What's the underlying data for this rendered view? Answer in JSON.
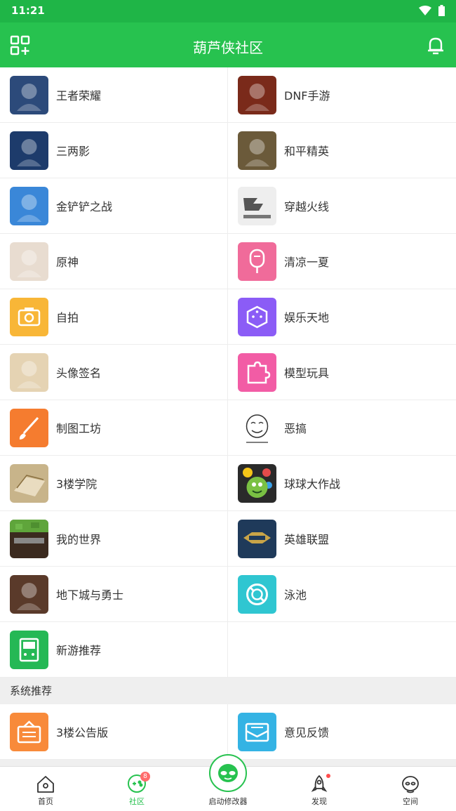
{
  "status": {
    "time": "11:21"
  },
  "header": {
    "title": "葫芦侠社区"
  },
  "icons": {
    "left": "qr-add-icon",
    "right": "bell-icon"
  },
  "colors": {
    "primary": "#27c24f",
    "status": "#1fb547"
  },
  "forums": [
    {
      "name": "王者荣耀",
      "icon": "honor-of-kings-icon",
      "color": "#2c4a7a"
    },
    {
      "name": "DNF手游",
      "icon": "dnf-icon",
      "color": "#7a2a1a"
    },
    {
      "name": "三两影",
      "icon": "sanliangying-icon",
      "color": "#1d3b6b"
    },
    {
      "name": "和平精英",
      "icon": "peace-elite-icon",
      "color": "#6b5a3a"
    },
    {
      "name": "金铲铲之战",
      "icon": "golden-spatula-icon",
      "color": "#3a87d8"
    },
    {
      "name": "穿越火线",
      "icon": "crossfire-icon",
      "color": "#bbbbbb"
    },
    {
      "name": "原神",
      "icon": "genshin-icon",
      "color": "#e8dcd0"
    },
    {
      "name": "清凉一夏",
      "icon": "ice-pop-icon",
      "color": "#f06b9a"
    },
    {
      "name": "自拍",
      "icon": "camera-icon",
      "color": "#f8b637"
    },
    {
      "name": "娱乐天地",
      "icon": "dice-icon",
      "color": "#8b5cf6"
    },
    {
      "name": "头像签名",
      "icon": "avatar-signature-icon",
      "color": "#e5d3b3"
    },
    {
      "name": "模型玩具",
      "icon": "puzzle-icon",
      "color": "#f25ca5"
    },
    {
      "name": "制图工坊",
      "icon": "brush-icon",
      "color": "#f57c2f"
    },
    {
      "name": "恶搞",
      "icon": "meme-face-icon",
      "color": "#ffffff"
    },
    {
      "name": "3楼学院",
      "icon": "books-icon",
      "color": "#c8b48a"
    },
    {
      "name": "球球大作战",
      "icon": "balls-icon",
      "color": "#7ac143"
    },
    {
      "name": "我的世界",
      "icon": "minecraft-icon",
      "color": "#3b2a1f"
    },
    {
      "name": "英雄联盟",
      "icon": "lol-icon",
      "color": "#1f3a5a"
    },
    {
      "name": "地下城与勇士",
      "icon": "dnf-pc-icon",
      "color": "#5a3a2a"
    },
    {
      "name": "泳池",
      "icon": "lifebuoy-icon",
      "color": "#2fc6d1"
    },
    {
      "name": "新游推荐",
      "icon": "new-game-icon",
      "color": "#25b855"
    }
  ],
  "system_section": {
    "title": "系统推荐",
    "items": [
      {
        "name": "3楼公告版",
        "icon": "notice-board-icon",
        "color": "#f88a3a"
      },
      {
        "name": "意见反馈",
        "icon": "feedback-mail-icon",
        "color": "#34b3e4"
      }
    ]
  },
  "tabs": [
    {
      "label": "首页",
      "icon": "home-icon"
    },
    {
      "label": "社区",
      "icon": "community-icon",
      "badge": "8"
    },
    {
      "label": "启动修改器",
      "icon": "alien-launcher-icon"
    },
    {
      "label": "发现",
      "icon": "rocket-icon"
    },
    {
      "label": "空间",
      "icon": "profile-face-icon"
    }
  ]
}
